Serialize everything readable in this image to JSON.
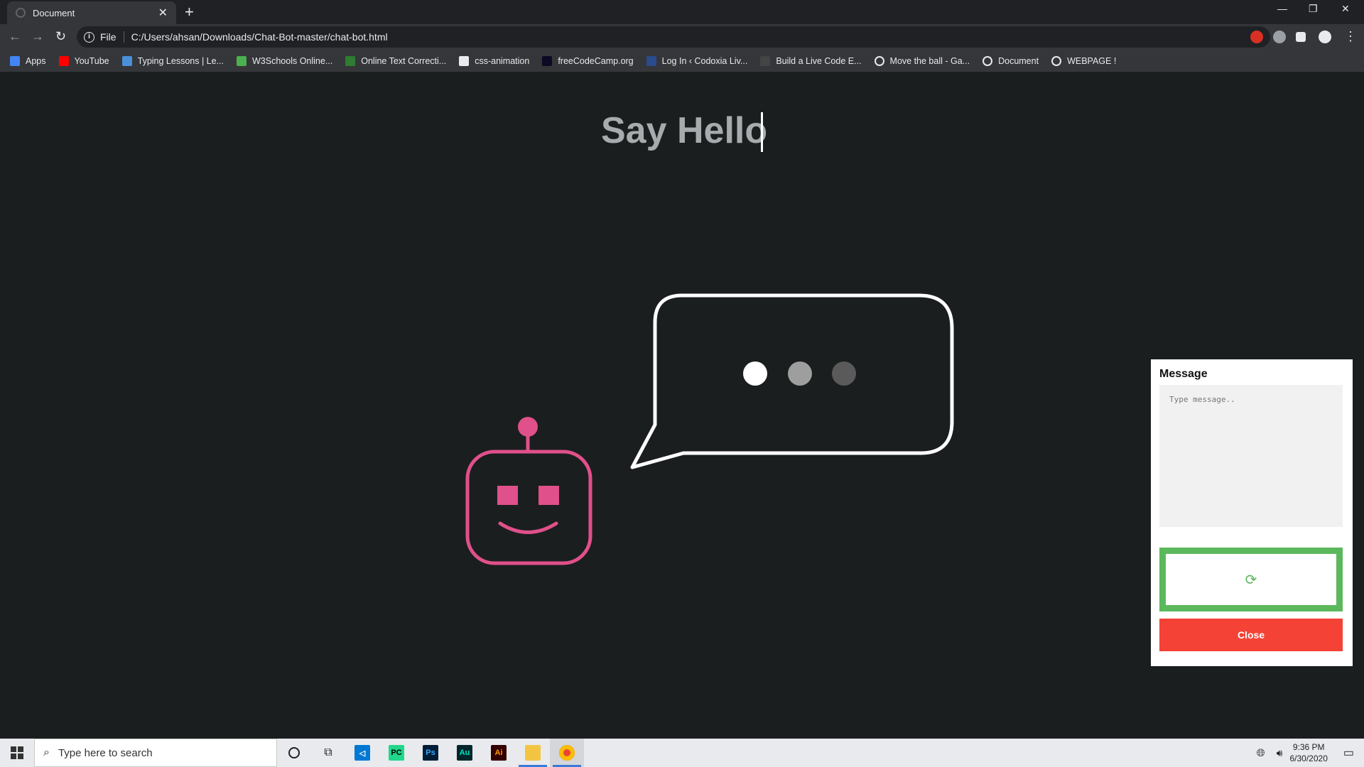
{
  "browser": {
    "tab_title": "Document",
    "scheme_label": "File",
    "url": "C:/Users/ahsan/Downloads/Chat-Bot-master/chat-bot.html",
    "bookmarks": [
      {
        "label": "Apps",
        "icon": "apps-grid-icon",
        "color": "#4285f4"
      },
      {
        "label": "YouTube",
        "icon": "youtube-icon",
        "color": "#ff0000"
      },
      {
        "label": "Typing Lessons | Le...",
        "icon": "typing-icon",
        "color": "#4a90d9"
      },
      {
        "label": "W3Schools Online...",
        "icon": "w3schools-icon",
        "color": "#4caf50"
      },
      {
        "label": "Online Text Correcti...",
        "icon": "check-icon",
        "color": "#2e7d32"
      },
      {
        "label": "css-animation",
        "icon": "css-animation-icon",
        "color": "#e8eaed"
      },
      {
        "label": "freeCodeCamp.org",
        "icon": "freecodecamp-icon",
        "color": "#0a0a23"
      },
      {
        "label": "Log In ‹ Codoxia Liv...",
        "icon": "codoxia-icon",
        "color": "#2a4b8d"
      },
      {
        "label": "Build a Live Code E...",
        "icon": "code-icon",
        "color": "#444"
      },
      {
        "label": "Move the ball - Ga...",
        "icon": "globe-icon",
        "color": "#e8eaed"
      },
      {
        "label": "Document",
        "icon": "globe-icon",
        "color": "#e8eaed"
      },
      {
        "label": "WEBPAGE !",
        "icon": "globe-icon",
        "color": "#e8eaed"
      }
    ]
  },
  "page": {
    "headline": "Say Hello",
    "colors": {
      "robot": "#e0508a",
      "bubble": "#ffffff",
      "dot1": "#ffffff",
      "dot2": "#9e9e9e",
      "dot3": "#5a5a5a"
    }
  },
  "chat": {
    "title": "Message",
    "placeholder": "Type message..",
    "send_icon": "refresh-icon",
    "close_label": "Close",
    "colors": {
      "send_border": "#5cb85c",
      "close_bg": "#f44336"
    }
  },
  "taskbar": {
    "search_placeholder": "Type here to search",
    "time": "9:36 PM",
    "date": "6/30/2020"
  }
}
